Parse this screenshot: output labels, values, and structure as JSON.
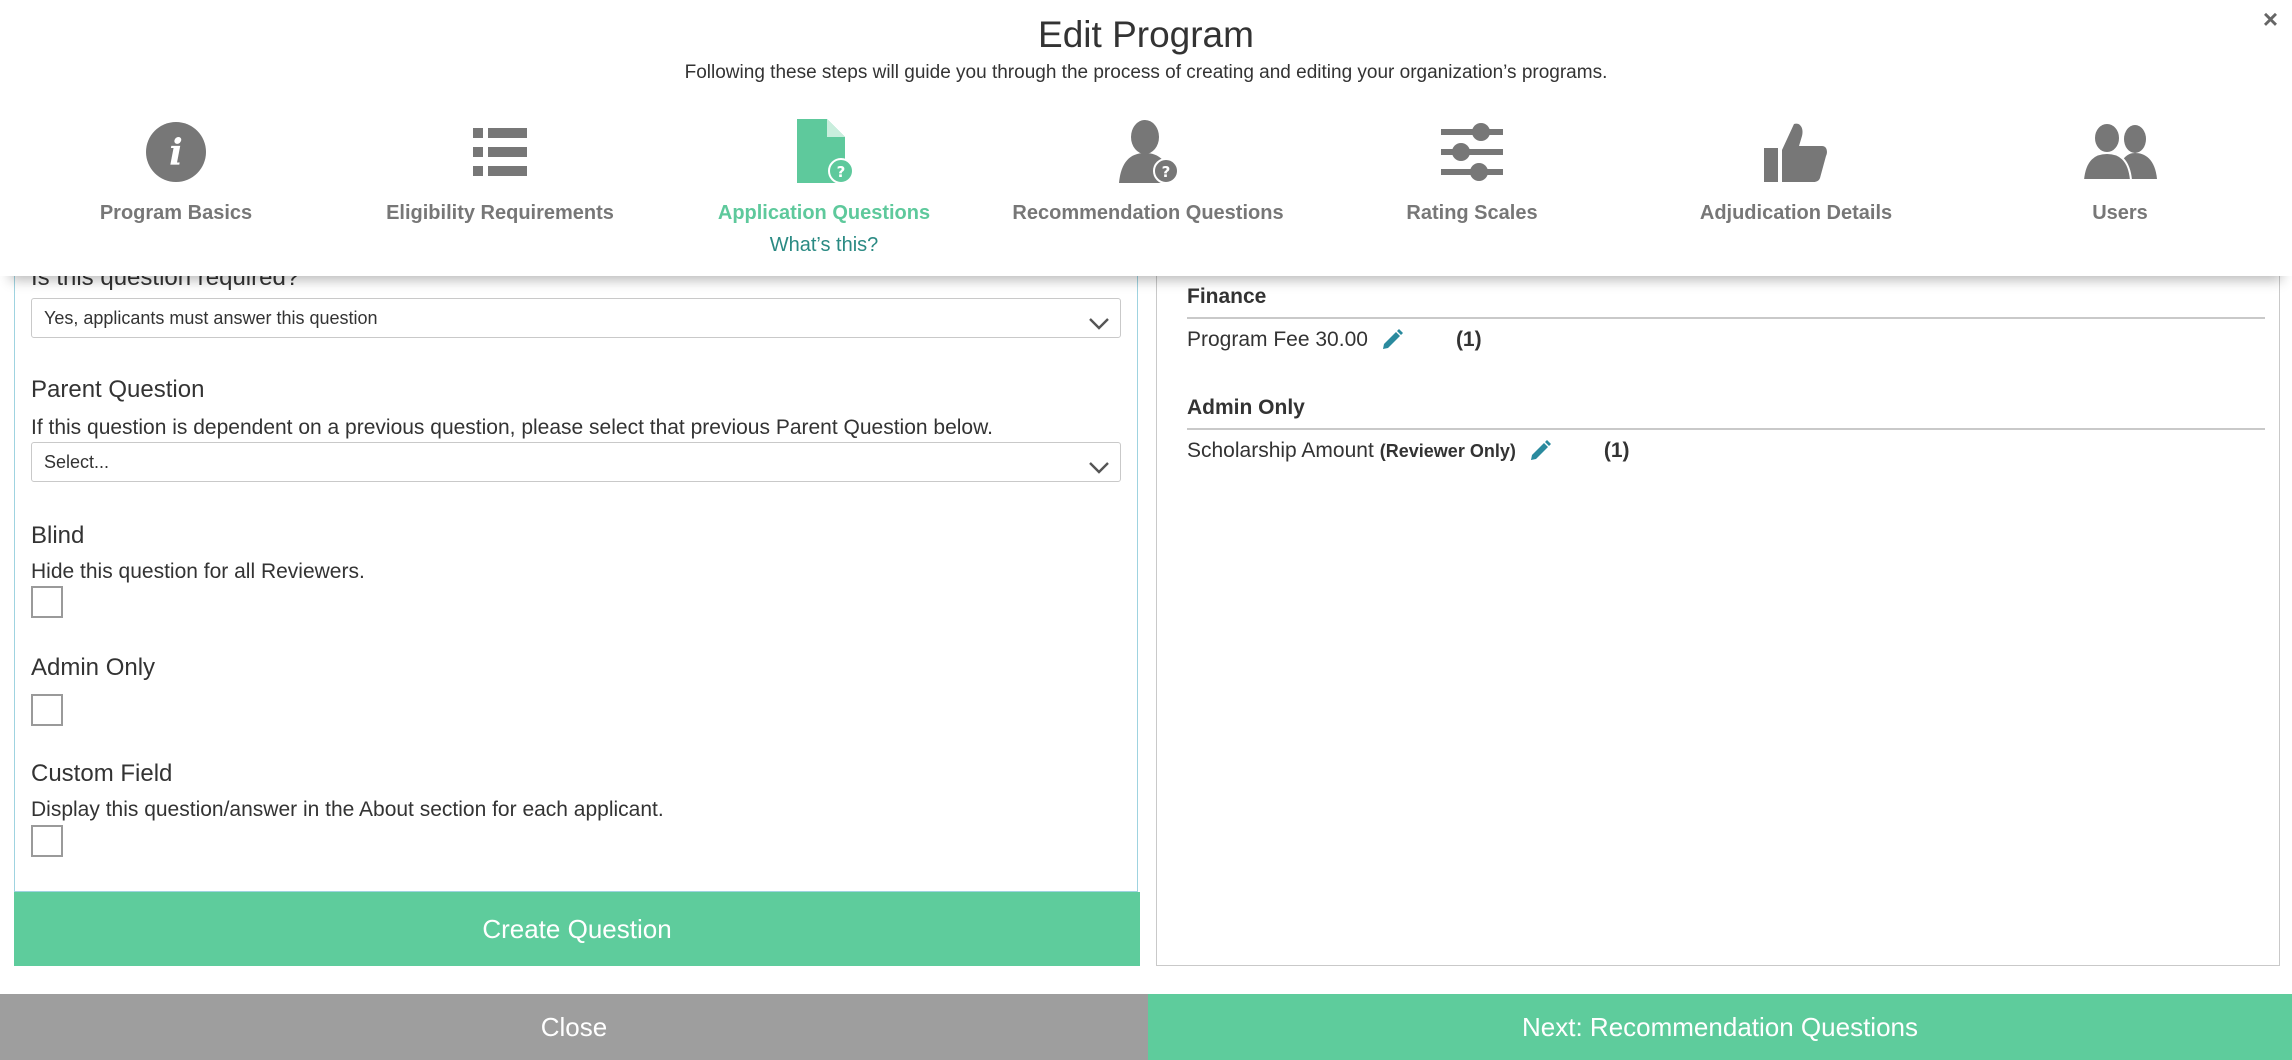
{
  "header": {
    "title": "Edit Program",
    "subtitle": "Following these steps will guide you through the process of creating and editing your organization’s programs.",
    "close_symbol": "×"
  },
  "steps": [
    {
      "label": "Program Basics",
      "icon": "info-icon"
    },
    {
      "label": "Eligibility Requirements",
      "icon": "list-icon"
    },
    {
      "label": "Application Questions",
      "icon": "document-question-icon",
      "active": true
    },
    {
      "label": "Recommendation Questions",
      "icon": "person-question-icon"
    },
    {
      "label": "Rating Scales",
      "icon": "sliders-icon"
    },
    {
      "label": "Adjudication Details",
      "icon": "thumbs-up-icon"
    },
    {
      "label": "Users",
      "icon": "users-icon"
    }
  ],
  "whats_this": "What’s this?",
  "colors": {
    "accent": "#5ecc9c",
    "active_step": "#5ec99c",
    "link": "#2a8a83",
    "icon_gray": "#777777",
    "close_button": "#9e9e9e"
  },
  "form": {
    "required": {
      "label": "Is this question required?",
      "value": "Yes, applicants must answer this question"
    },
    "parent": {
      "heading": "Parent Question",
      "description": "If this question is dependent on a previous question, please select that previous Parent Question below.",
      "value": "Select..."
    },
    "blind": {
      "heading": "Blind",
      "description": "Hide this question for all Reviewers.",
      "checked": false
    },
    "admin_only": {
      "heading": "Admin Only",
      "checked": false
    },
    "custom_field": {
      "heading": "Custom Field",
      "description": "Display this question/answer in the About section for each applicant.",
      "checked": false
    },
    "create_label": "Create Question"
  },
  "sections": [
    {
      "heading": "Finance",
      "items": [
        {
          "name": "Program Fee 30.00",
          "tag": "",
          "count": "(1)"
        }
      ]
    },
    {
      "heading": "Admin Only",
      "items": [
        {
          "name": "Scholarship Amount",
          "tag": "(Reviewer Only)",
          "count": "(1)"
        }
      ]
    }
  ],
  "footer": {
    "close_label": "Close",
    "next_label": "Next: Recommendation Questions"
  }
}
